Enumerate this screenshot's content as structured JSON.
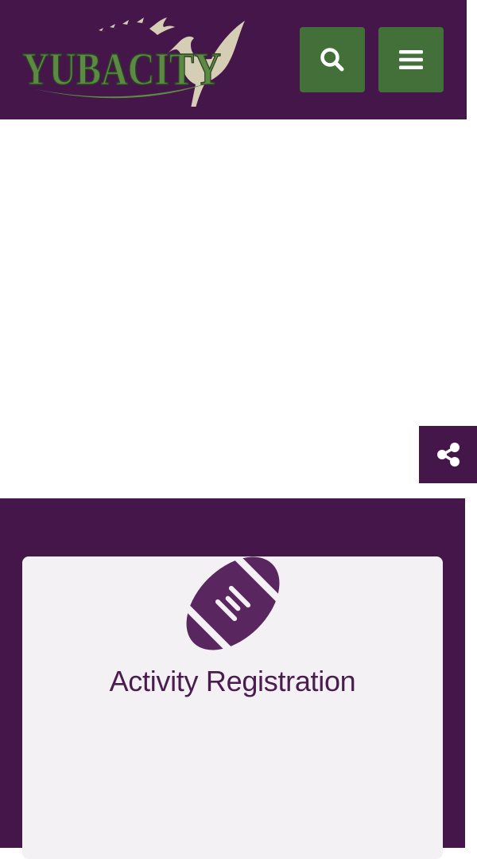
{
  "header": {
    "logo_text": "YubaCity",
    "search_label": "",
    "menu_label": ""
  },
  "share": {
    "icon": "share-icon"
  },
  "cards": [
    {
      "title": "Activity Registration",
      "icon": "football-icon"
    }
  ],
  "colors": {
    "brand_purple": "#45164a",
    "brand_green": "#437039",
    "card_bg": "#f4f1f5",
    "title_text": "#4a1d4f",
    "logo_tan": "#d6cdb5",
    "logo_green": "#5c8a44"
  }
}
